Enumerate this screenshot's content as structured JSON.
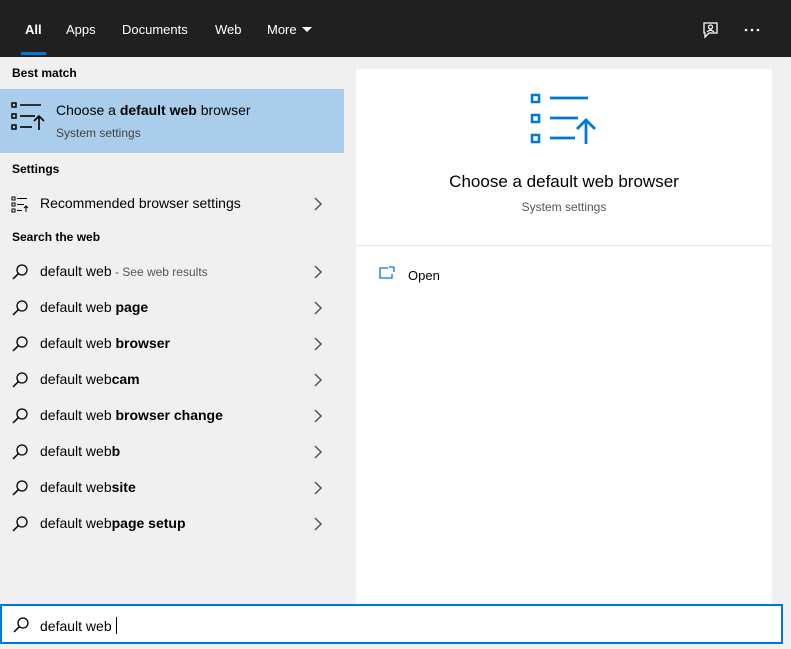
{
  "tabs": [
    {
      "label": "All",
      "active": true
    },
    {
      "label": "Apps"
    },
    {
      "label": "Documents"
    },
    {
      "label": "Web"
    },
    {
      "label": "More"
    }
  ],
  "topbar_icons": [
    "feedback-icon",
    "more-options-icon"
  ],
  "best_match": {
    "header": "Best match",
    "title_pre": "Choose a ",
    "title_bold": "default web",
    "title_post": " browser",
    "subtitle": "System settings"
  },
  "settings": {
    "header": "Settings",
    "items": [
      {
        "label": "Recommended browser settings"
      }
    ]
  },
  "web": {
    "header": "Search the web",
    "items": [
      {
        "plain": "default web",
        "bold": "",
        "hint": " - See web results"
      },
      {
        "plain": "default web ",
        "bold": "page",
        "hint": ""
      },
      {
        "plain": "default web ",
        "bold": "browser",
        "hint": ""
      },
      {
        "plain": "default web",
        "bold": "cam",
        "hint": ""
      },
      {
        "plain": "default web ",
        "bold": "browser change",
        "hint": ""
      },
      {
        "plain": "default web",
        "bold": "b",
        "hint": ""
      },
      {
        "plain": "default web",
        "bold": "site",
        "hint": ""
      },
      {
        "plain": "default web",
        "bold": "page setup",
        "hint": ""
      }
    ]
  },
  "preview": {
    "title": "Choose a default web browser",
    "subtitle": "System settings",
    "action": "Open"
  },
  "search": {
    "value": "default web"
  },
  "colors": {
    "accent": "#0078d7",
    "selected": "#a9cdea",
    "topbar": "#202020"
  }
}
